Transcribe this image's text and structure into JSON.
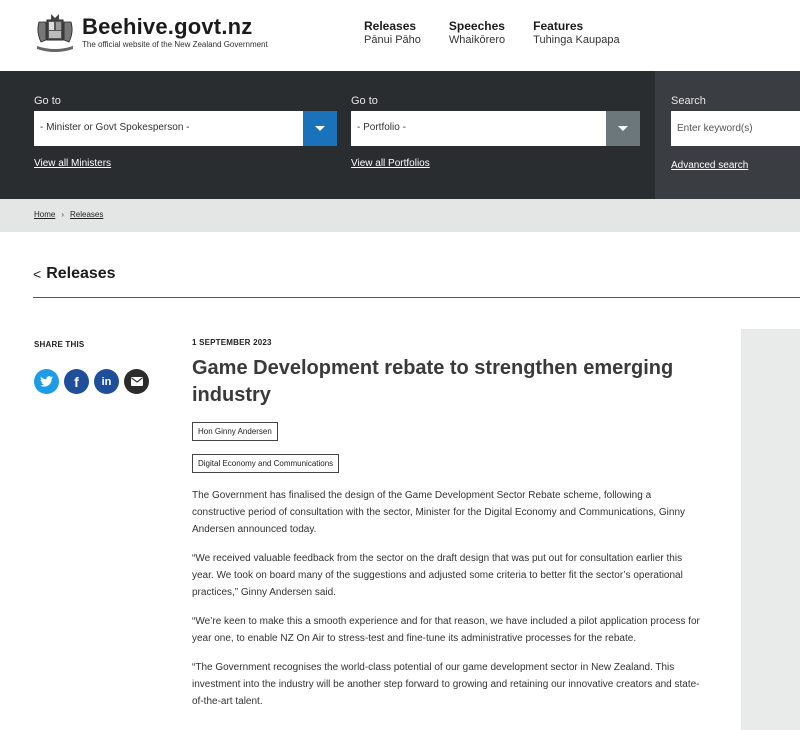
{
  "header": {
    "site_title": "Beehive.govt.nz",
    "site_subtitle": "The official website of the New Zealand Government",
    "logo_icon": "nz-coat-of-arms-icon",
    "nav": [
      {
        "label": "Releases",
        "sublabel": "Pānui Pāho"
      },
      {
        "label": "Speeches",
        "sublabel": "Whaikōrero"
      },
      {
        "label": "Features",
        "sublabel": "Tuhinga Kaupapa"
      }
    ]
  },
  "search_band": {
    "ministers": {
      "label": "Go to",
      "selected": "- Minister or Govt Spokesperson -",
      "link": "View all Ministers",
      "arrow_color": "#1a73ba"
    },
    "portfolios": {
      "label": "Go to",
      "selected": "- Portfolio -",
      "link": "View all Portfolios",
      "arrow_color": "#6b777b"
    },
    "search": {
      "label": "Search",
      "placeholder": "Enter keyword(s)",
      "link": "Advanced search"
    }
  },
  "breadcrumb": [
    "Home",
    "Releases"
  ],
  "section": {
    "back_label": "Releases"
  },
  "share": {
    "label": "SHARE THIS",
    "icons": [
      {
        "name": "twitter-icon",
        "glyph": "t",
        "color": "#1d9be6"
      },
      {
        "name": "facebook-icon",
        "glyph": "f",
        "color": "#1f4f9a"
      },
      {
        "name": "linkedin-icon",
        "glyph": "in",
        "color": "#1f4f9a"
      },
      {
        "name": "email-icon",
        "glyph": "✉",
        "color": "#2b2b2b"
      }
    ]
  },
  "article": {
    "date": "1 SEPTEMBER 2023",
    "title": "Game Development rebate to strengthen emerging industry",
    "tags": [
      "Hon Ginny Andersen",
      "Digital Economy and Communications"
    ],
    "paragraphs": [
      "The Government has finalised the design of the Game Development Sector Rebate scheme, following a constructive period of consultation with the sector, Minister for the Digital Economy and Communications, Ginny Andersen announced today.",
      "“We received valuable feedback from the sector on the draft design that was put out for consultation earlier this year. We took on board many of the suggestions and adjusted some criteria to better fit the sector’s operational practices,” Ginny Andersen said.",
      "“We’re keen to make this a smooth experience and for that reason, we have included a pilot application process for year one, to enable NZ On Air to stress-test and fine-tune its administrative processes for the rebate.",
      "“The Government recognises the world-class potential of our game development sector in New Zealand. This investment into the industry will be another step forward to growing and retaining our innovative creators and state-of-the-art talent."
    ]
  }
}
